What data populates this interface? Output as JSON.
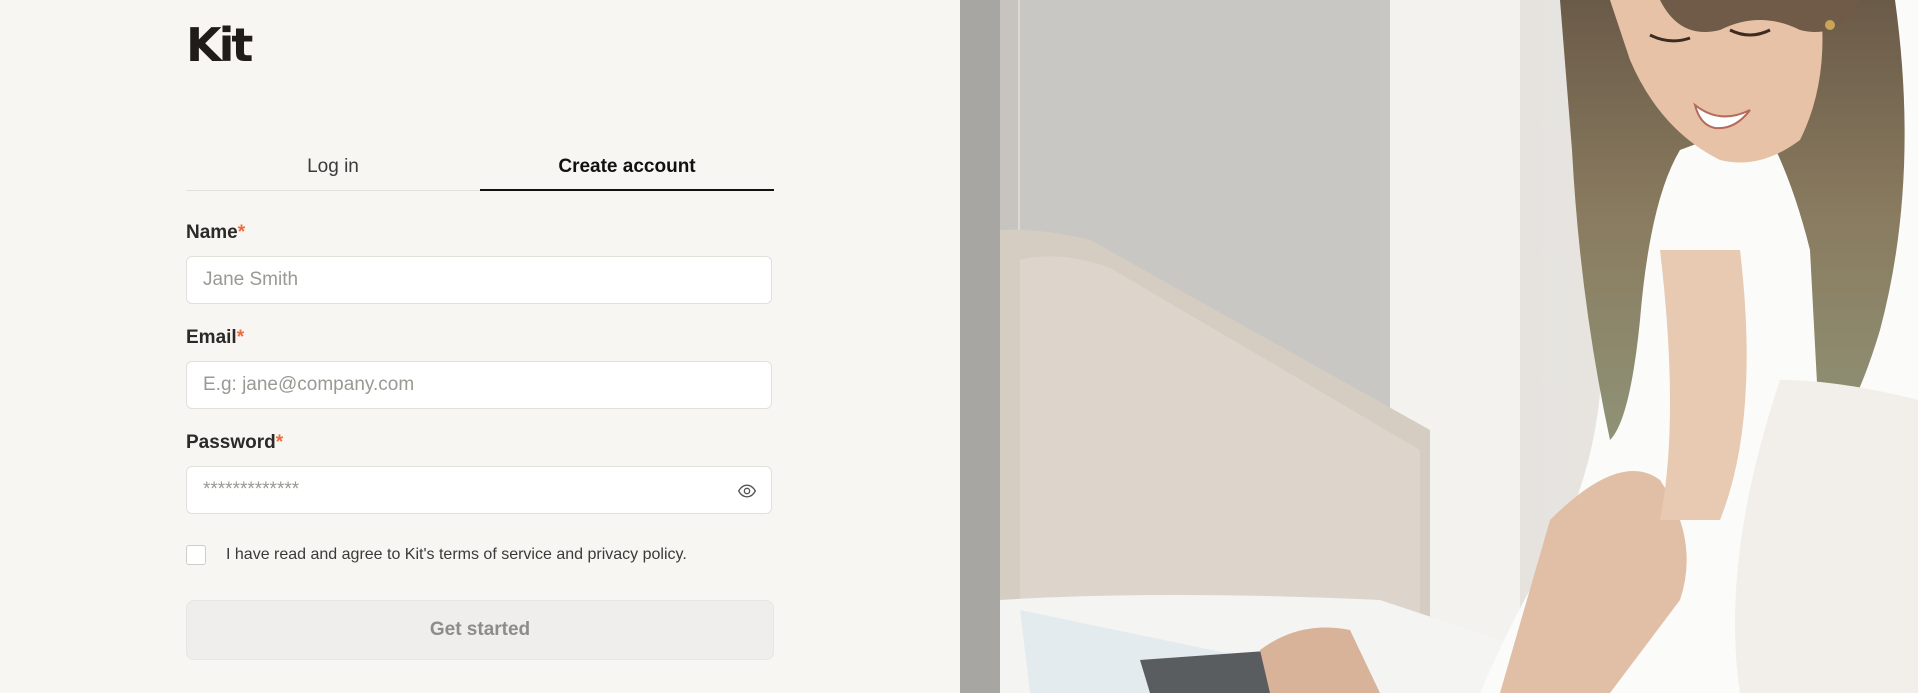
{
  "brand": {
    "logo_text": "Kit"
  },
  "tabs": [
    {
      "label": "Log in",
      "active": false
    },
    {
      "label": "Create account",
      "active": true
    }
  ],
  "form": {
    "required_mark": "*",
    "name": {
      "label": "Name",
      "placeholder": "Jane Smith",
      "value": ""
    },
    "email": {
      "label": "Email",
      "placeholder": "E.g: jane@company.com",
      "value": ""
    },
    "password": {
      "label": "Password",
      "placeholder": "*************",
      "value": "",
      "toggle_icon": "eye-icon"
    },
    "terms": {
      "label": "I have read and agree to Kit's terms of service and privacy policy.",
      "checked": false
    },
    "submit_label": "Get started"
  },
  "colors": {
    "accent_required": "#ef6a3c",
    "background": "#f7f6f2",
    "text": "#1d1d1b"
  }
}
